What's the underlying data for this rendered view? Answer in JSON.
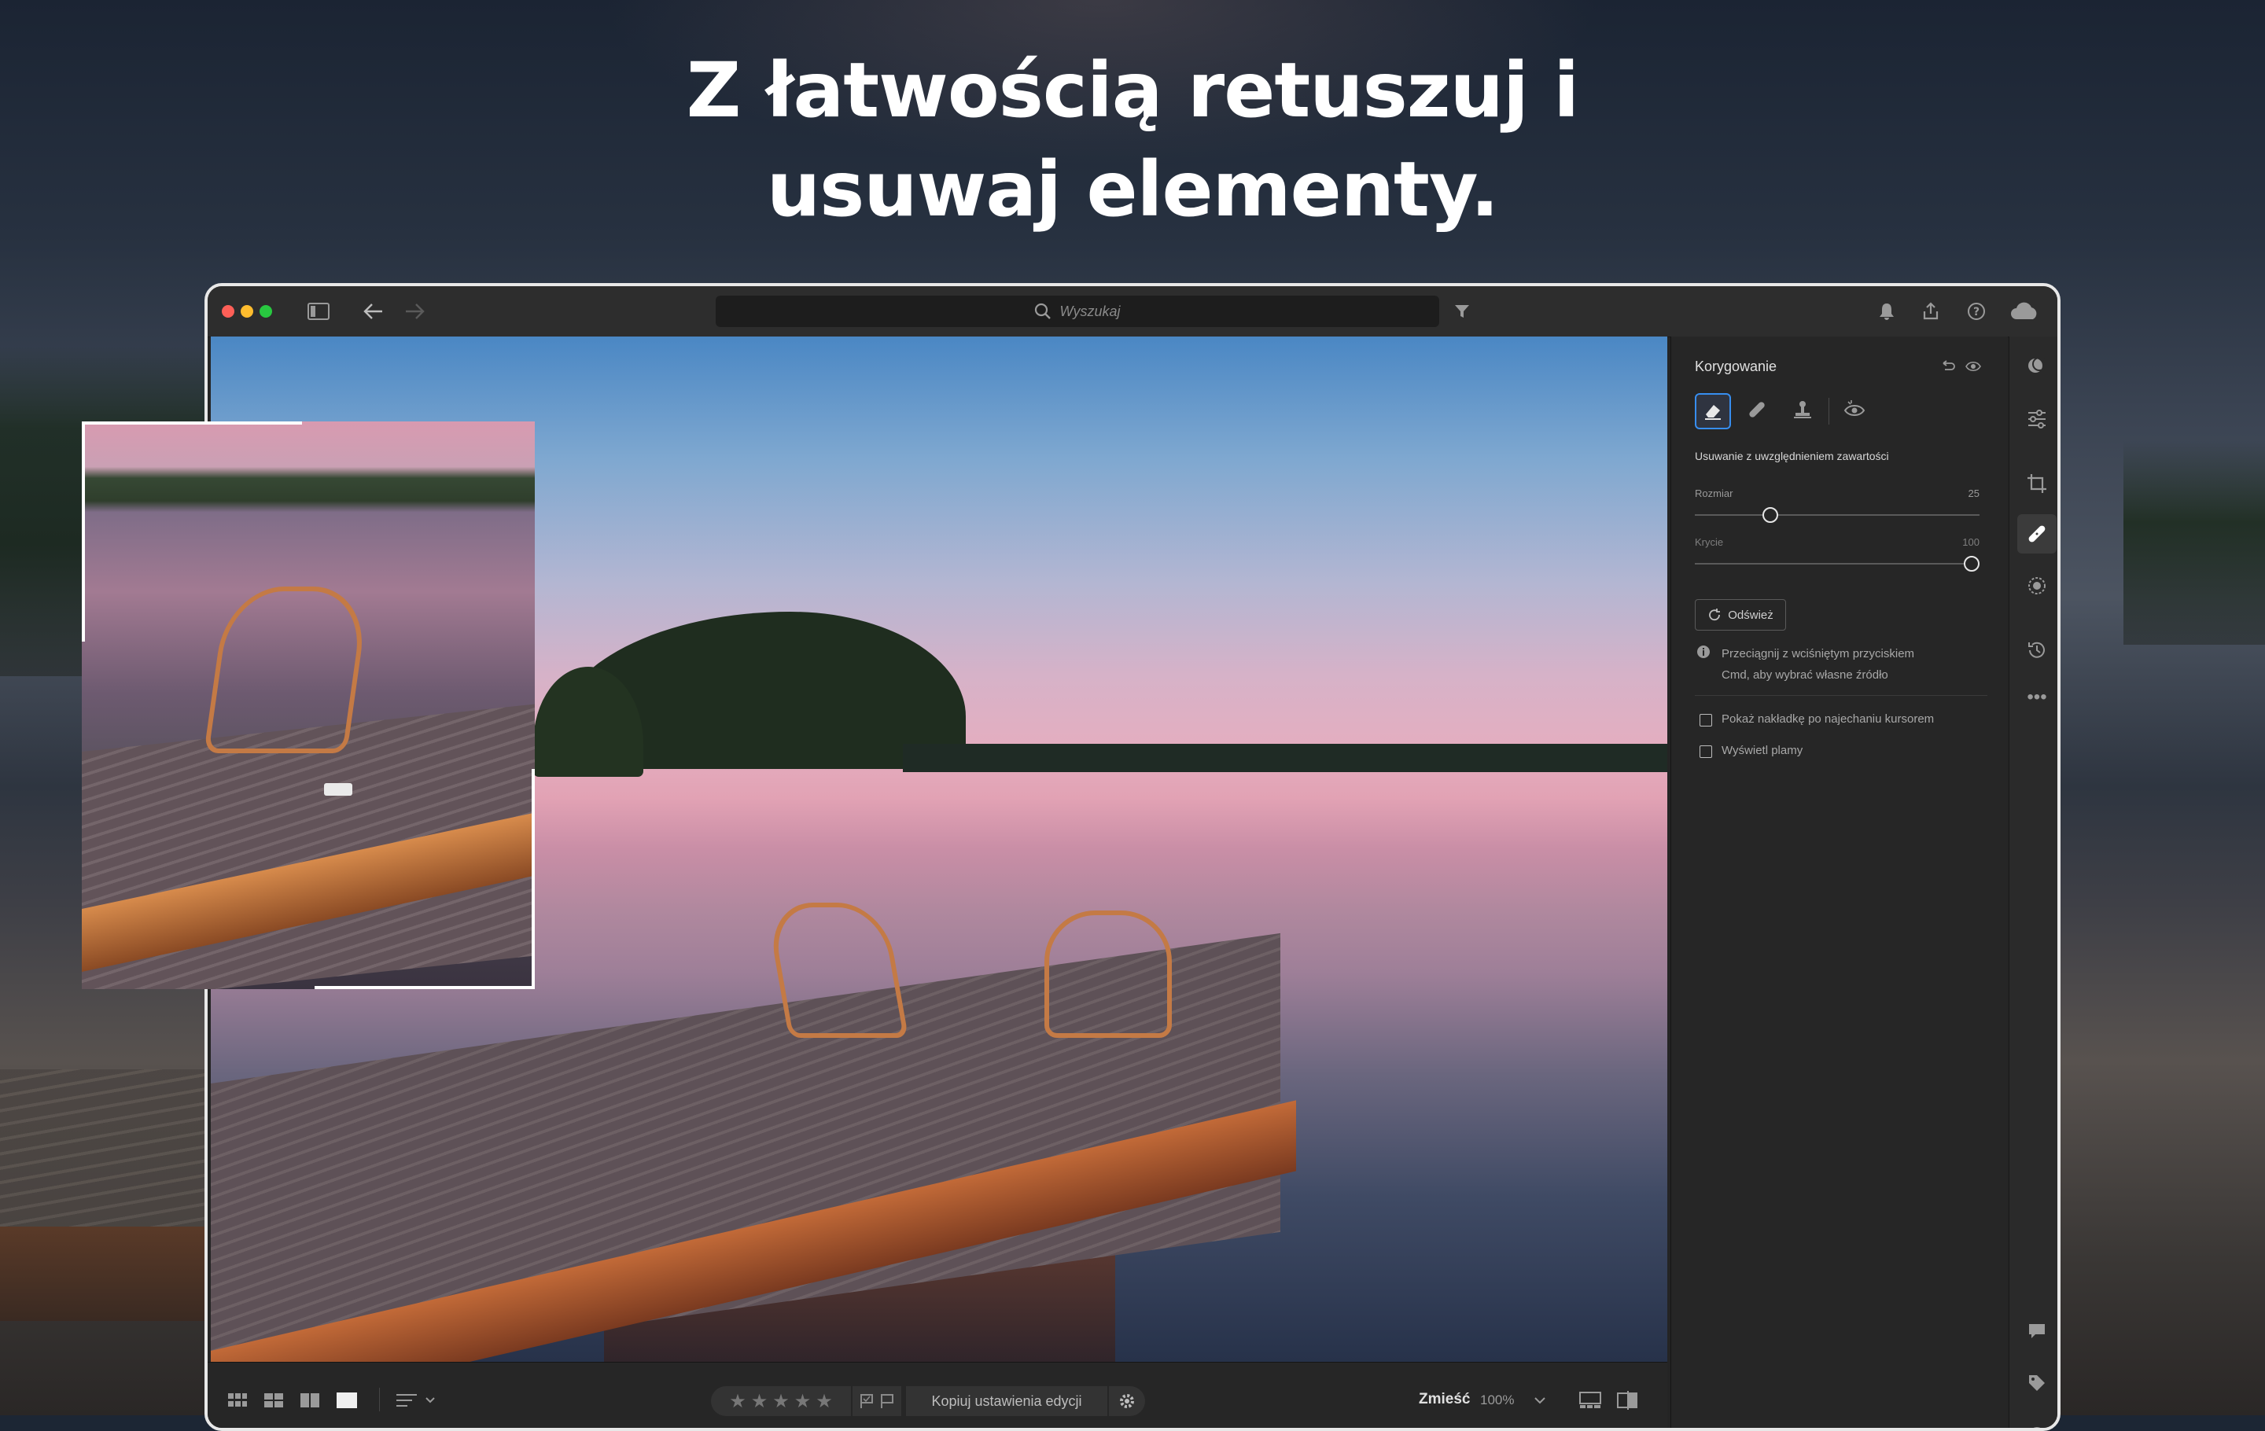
{
  "headline": {
    "line1": "Z łatwością retuszuj i",
    "line2": "usuwaj elementy."
  },
  "titlebar": {
    "search_placeholder": "Wyszukaj",
    "traffic_colors": [
      "#fe5f57",
      "#febc2e",
      "#28c840"
    ]
  },
  "panel": {
    "title": "Korygowanie",
    "tools": [
      "eraser-icon",
      "healing-icon",
      "stamp-icon",
      "red-eye-icon"
    ],
    "mode_label": "Usuwanie z uwzględnieniem zawartości",
    "size_label": "Rozmiar",
    "size_value": "25",
    "size_fraction": 0.25,
    "opacity_label": "Krycie",
    "opacity_value": "100",
    "opacity_fraction": 1.0,
    "refresh_label": "Odśwież",
    "info_line1": "Przeciągnij z wciśniętym przyciskiem",
    "info_line2": "Cmd, aby wybrać własne źródło",
    "checkbox1": "Pokaż nakładkę po najechaniu kursorem",
    "checkbox2": "Wyświetl plamy"
  },
  "bottombar": {
    "copy_label": "Kopiuj ustawienia edycji",
    "fit_label": "Zmieść",
    "zoom_value": "100%",
    "stars": [
      "★",
      "★",
      "★",
      "★",
      "★"
    ]
  },
  "colors": {
    "accent": "#378ef0",
    "window_bg": "#242424",
    "panel_bg": "#262626"
  }
}
